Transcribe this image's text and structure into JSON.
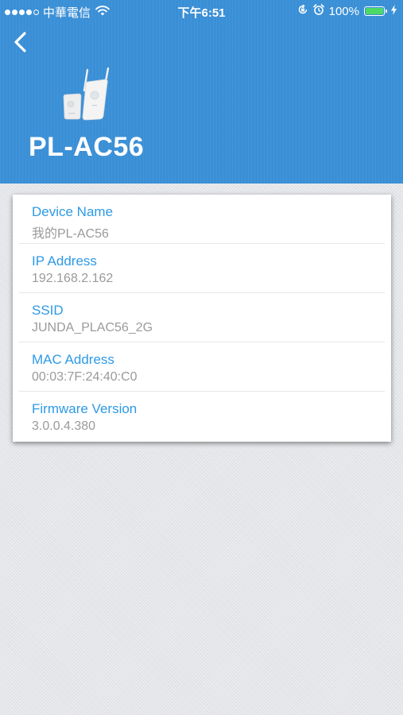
{
  "status_bar": {
    "carrier": "中華電信",
    "time": "下午6:51",
    "battery_percent": "100%",
    "signal_bars_filled": 4,
    "signal_bars_total": 5,
    "icons": [
      "wifi-icon",
      "orientation-lock-icon",
      "alarm-icon",
      "battery-icon",
      "charging-bolt-icon"
    ]
  },
  "header": {
    "back_icon": "chevron-left-icon",
    "device_image": "powerline-adapter-image",
    "title": "PL-AC56",
    "background_color": "#3a8fd6"
  },
  "details": [
    {
      "label": "Device Name",
      "value": "我的PL-AC56"
    },
    {
      "label": "IP Address",
      "value": "192.168.2.162"
    },
    {
      "label": "SSID",
      "value": "JUNDA_PLAC56_2G"
    },
    {
      "label": "MAC Address",
      "value": "00:03:7F:24:40:C0"
    },
    {
      "label": "Firmware Version",
      "value": "3.0.0.4.380"
    }
  ],
  "colors": {
    "label": "#2d9ae6",
    "value": "#9a9a9a",
    "battery_fill": "#4cd964"
  }
}
